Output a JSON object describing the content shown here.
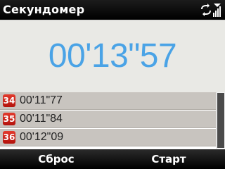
{
  "header": {
    "title": "Секундомер",
    "icons": [
      "sync-icon",
      "signal-icon"
    ]
  },
  "main": {
    "time_display": "00'13\"57"
  },
  "laps": [
    {
      "number": "34",
      "time": "00'11\"77"
    },
    {
      "number": "35",
      "time": "00'11\"84"
    },
    {
      "number": "36",
      "time": "00'12\"09"
    }
  ],
  "softkeys": {
    "left": "Сброс",
    "right": "Старт"
  },
  "colors": {
    "accent": "#4aa3e6",
    "lap_bg": "#c8c4bf",
    "badge_red": "#c7160f",
    "bar_black": "#000000"
  }
}
